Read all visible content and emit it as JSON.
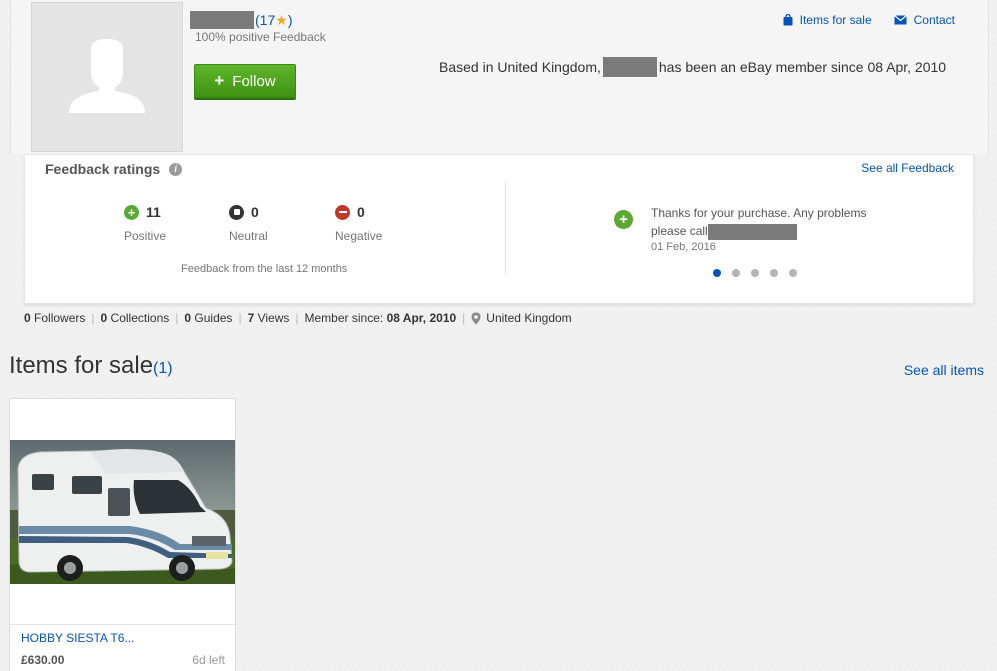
{
  "profile": {
    "feedback_score": "17",
    "score_open": "(",
    "score_close": ")",
    "star": "★",
    "positive_feedback": "100% positive Feedback",
    "follow_label": "Follow",
    "items_for_sale_link": "Items for sale",
    "contact_link": "Contact",
    "member_prefix": "Based in United Kingdom,",
    "member_suffix": "has been an eBay member since 08 Apr, 2010"
  },
  "feedback": {
    "title": "Feedback ratings",
    "see_all": "See all Feedback",
    "positive": {
      "count": "11",
      "label": "Positive"
    },
    "neutral": {
      "count": "0",
      "label": "Neutral"
    },
    "negative": {
      "count": "0",
      "label": "Negative"
    },
    "period": "Feedback from the last 12 months",
    "comment_text": "Thanks for your purchase. Any problems please call",
    "comment_date": "01 Feb, 2016",
    "carousel_count": 5,
    "carousel_active": 0
  },
  "stats": {
    "followers_count": "0",
    "followers_label": "Followers",
    "collections_count": "0",
    "collections_label": "Collections",
    "guides_count": "0",
    "guides_label": "Guides",
    "views_count": "7",
    "views_label": "Views",
    "member_since_label": "Member since:",
    "member_since_value": "08 Apr, 2010",
    "location": "United Kingdom",
    "separator": "|"
  },
  "items_section": {
    "title": "Items for sale",
    "count": "(1)",
    "see_all": "See all items",
    "items": [
      {
        "title": "HOBBY SIESTA T6...",
        "price": "£630.00",
        "time_left": "6d left"
      }
    ]
  },
  "colors": {
    "link": "#0654ba",
    "follow_green": "#4ca21f",
    "positive": "#5ba832",
    "negative": "#c0392b",
    "star": "#f5a623"
  },
  "icons": {
    "items_for_sale": "bag-icon",
    "contact": "envelope-icon",
    "info": "info-icon",
    "location": "map-pin-icon"
  }
}
